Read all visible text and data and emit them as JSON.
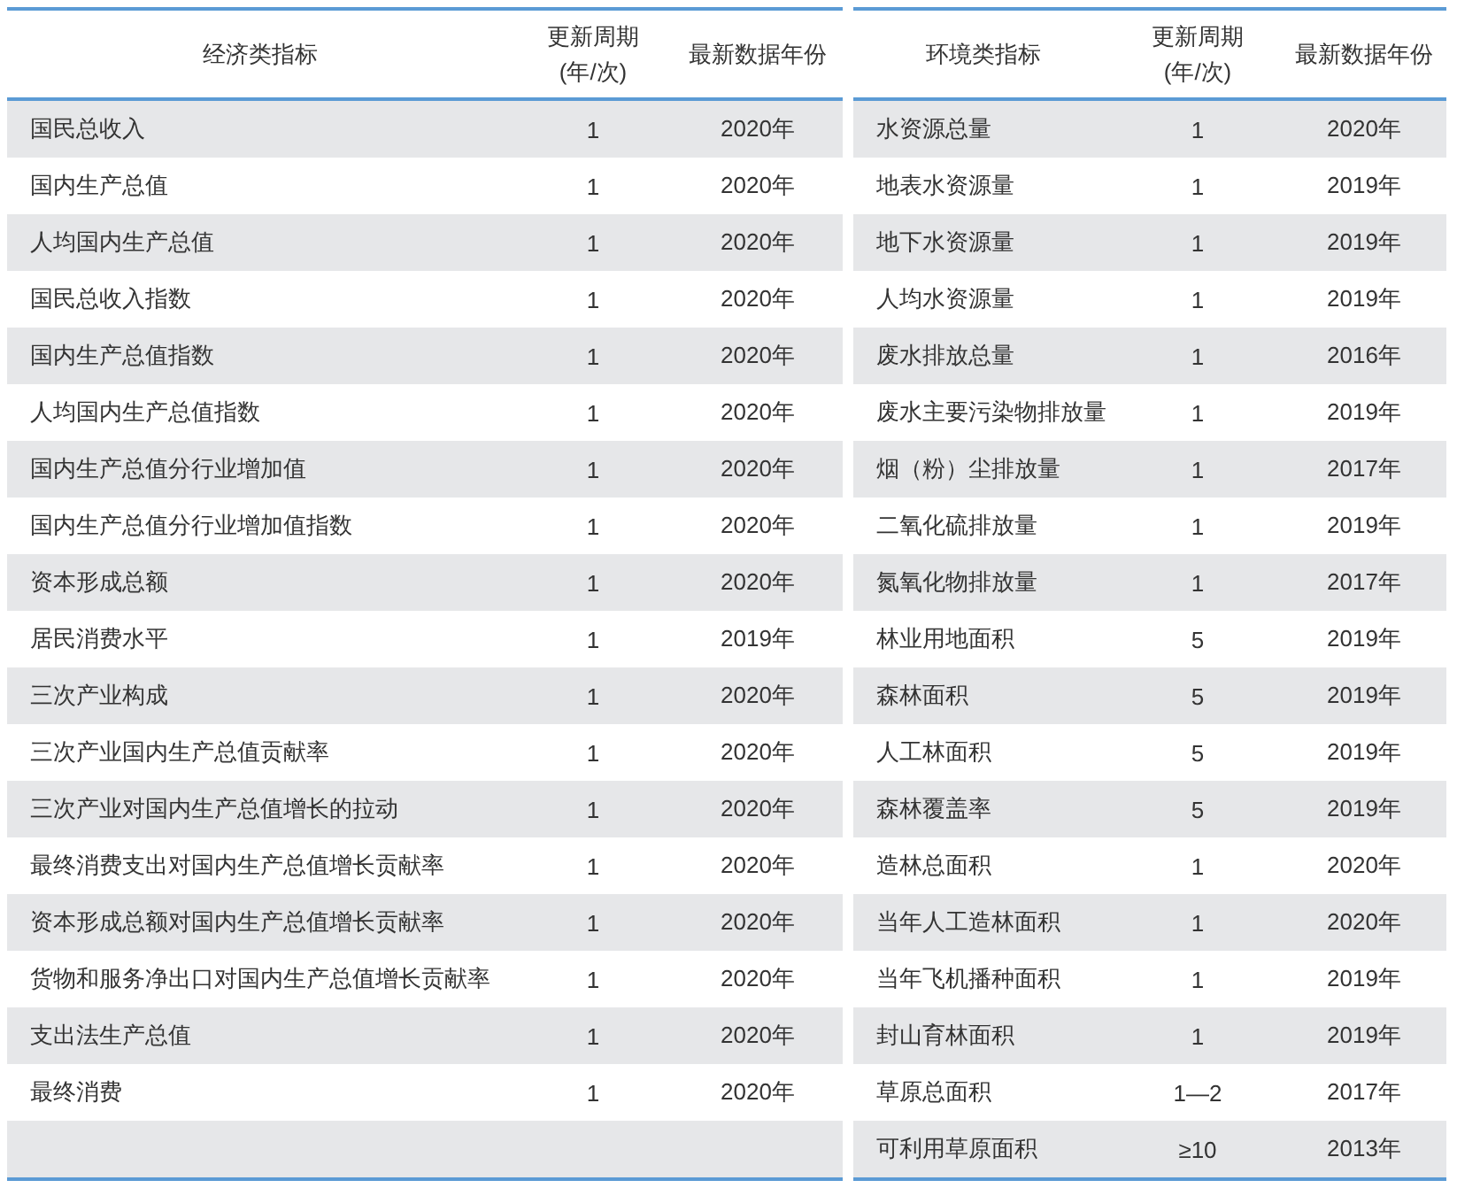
{
  "tables": [
    {
      "columns": [
        "经济类指标",
        "更新周期\n(年/次)",
        "最新数据年份"
      ],
      "rows": [
        [
          "国民总收入",
          "1",
          "2020年"
        ],
        [
          "国内生产总值",
          "1",
          "2020年"
        ],
        [
          "人均国内生产总值",
          "1",
          "2020年"
        ],
        [
          "国民总收入指数",
          "1",
          "2020年"
        ],
        [
          "国内生产总值指数",
          "1",
          "2020年"
        ],
        [
          "人均国内生产总值指数",
          "1",
          "2020年"
        ],
        [
          "国内生产总值分行业增加值",
          "1",
          "2020年"
        ],
        [
          "国内生产总值分行业增加值指数",
          "1",
          "2020年"
        ],
        [
          "资本形成总额",
          "1",
          "2020年"
        ],
        [
          "居民消费水平",
          "1",
          "2019年"
        ],
        [
          "三次产业构成",
          "1",
          "2020年"
        ],
        [
          "三次产业国内生产总值贡献率",
          "1",
          "2020年"
        ],
        [
          "三次产业对国内生产总值增长的拉动",
          "1",
          "2020年"
        ],
        [
          "最终消费支出对国内生产总值增长贡献率",
          "1",
          "2020年"
        ],
        [
          "资本形成总额对国内生产总值增长贡献率",
          "1",
          "2020年"
        ],
        [
          "货物和服务净出口对国内生产总值增长贡献率",
          "1",
          "2020年"
        ],
        [
          "支出法生产总值",
          "1",
          "2020年"
        ],
        [
          "最终消费",
          "1",
          "2020年"
        ]
      ]
    },
    {
      "columns": [
        "环境类指标",
        "更新周期\n(年/次)",
        "最新数据年份"
      ],
      "rows": [
        [
          "水资源总量",
          "1",
          "2020年"
        ],
        [
          "地表水资源量",
          "1",
          "2019年"
        ],
        [
          "地下水资源量",
          "1",
          "2019年"
        ],
        [
          "人均水资源量",
          "1",
          "2019年"
        ],
        [
          "废水排放总量",
          "1",
          "2016年"
        ],
        [
          "废水主要污染物排放量",
          "1",
          "2019年"
        ],
        [
          "烟（粉）尘排放量",
          "1",
          "2017年"
        ],
        [
          "二氧化硫排放量",
          "1",
          "2019年"
        ],
        [
          "氮氧化物排放量",
          "1",
          "2017年"
        ],
        [
          "林业用地面积",
          "5",
          "2019年"
        ],
        [
          "森林面积",
          "5",
          "2019年"
        ],
        [
          "人工林面积",
          "5",
          "2019年"
        ],
        [
          "森林覆盖率",
          "5",
          "2019年"
        ],
        [
          "造林总面积",
          "1",
          "2020年"
        ],
        [
          "当年人工造林面积",
          "1",
          "2020年"
        ],
        [
          "当年飞机播种面积",
          "1",
          "2019年"
        ],
        [
          "封山育林面积",
          "1",
          "2019年"
        ],
        [
          "草原总面积",
          "1—2",
          "2017年"
        ],
        [
          "可利用草原面积",
          "≥10",
          "2013年"
        ]
      ]
    }
  ]
}
